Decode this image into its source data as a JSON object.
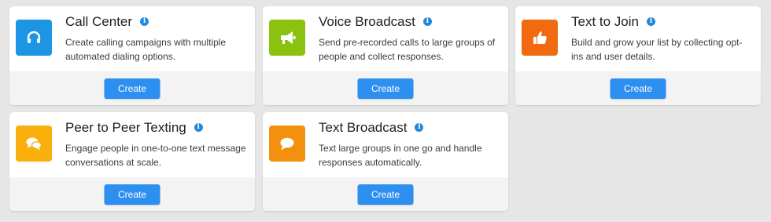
{
  "cards": [
    {
      "title": "Call Center",
      "description": "Create calling campaigns with multiple automated dialing options.",
      "button_label": "Create",
      "icon": "headset-icon",
      "color": "#1b95e4"
    },
    {
      "title": "Voice Broadcast",
      "description": "Send pre-recorded calls to large groups of people and collect responses.",
      "button_label": "Create",
      "icon": "megaphone-icon",
      "color": "#8ac20f"
    },
    {
      "title": "Text to Join",
      "description": "Build and grow your list by collecting opt-ins and user details.",
      "button_label": "Create",
      "icon": "thumbs-up-icon",
      "color": "#f26a0f"
    },
    {
      "title": "Peer to Peer Texting",
      "description": "Engage people in one-to-one text message conversations at scale.",
      "button_label": "Create",
      "icon": "chat-bubbles-icon",
      "color": "#f9b00c"
    },
    {
      "title": "Text Broadcast",
      "description": "Text large groups in one go and handle responses automatically.",
      "button_label": "Create",
      "icon": "chat-bubble-icon",
      "color": "#f3900d"
    }
  ],
  "colors": {
    "background": "#e6e6e6",
    "button": "#2d8ff0",
    "info_icon": "#2388d8"
  }
}
